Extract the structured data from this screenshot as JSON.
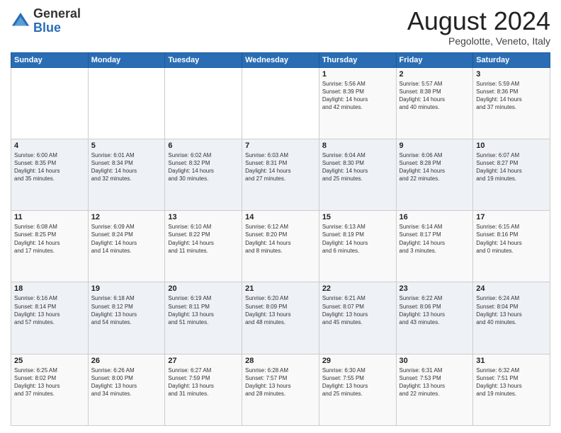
{
  "header": {
    "logo_general": "General",
    "logo_blue": "Blue",
    "month_title": "August 2024",
    "location": "Pegolotte, Veneto, Italy"
  },
  "weekdays": [
    "Sunday",
    "Monday",
    "Tuesday",
    "Wednesday",
    "Thursday",
    "Friday",
    "Saturday"
  ],
  "weeks": [
    [
      {
        "day": "",
        "info": ""
      },
      {
        "day": "",
        "info": ""
      },
      {
        "day": "",
        "info": ""
      },
      {
        "day": "",
        "info": ""
      },
      {
        "day": "1",
        "info": "Sunrise: 5:56 AM\nSunset: 8:39 PM\nDaylight: 14 hours\nand 42 minutes."
      },
      {
        "day": "2",
        "info": "Sunrise: 5:57 AM\nSunset: 8:38 PM\nDaylight: 14 hours\nand 40 minutes."
      },
      {
        "day": "3",
        "info": "Sunrise: 5:59 AM\nSunset: 8:36 PM\nDaylight: 14 hours\nand 37 minutes."
      }
    ],
    [
      {
        "day": "4",
        "info": "Sunrise: 6:00 AM\nSunset: 8:35 PM\nDaylight: 14 hours\nand 35 minutes."
      },
      {
        "day": "5",
        "info": "Sunrise: 6:01 AM\nSunset: 8:34 PM\nDaylight: 14 hours\nand 32 minutes."
      },
      {
        "day": "6",
        "info": "Sunrise: 6:02 AM\nSunset: 8:32 PM\nDaylight: 14 hours\nand 30 minutes."
      },
      {
        "day": "7",
        "info": "Sunrise: 6:03 AM\nSunset: 8:31 PM\nDaylight: 14 hours\nand 27 minutes."
      },
      {
        "day": "8",
        "info": "Sunrise: 6:04 AM\nSunset: 8:30 PM\nDaylight: 14 hours\nand 25 minutes."
      },
      {
        "day": "9",
        "info": "Sunrise: 6:06 AM\nSunset: 8:28 PM\nDaylight: 14 hours\nand 22 minutes."
      },
      {
        "day": "10",
        "info": "Sunrise: 6:07 AM\nSunset: 8:27 PM\nDaylight: 14 hours\nand 19 minutes."
      }
    ],
    [
      {
        "day": "11",
        "info": "Sunrise: 6:08 AM\nSunset: 8:25 PM\nDaylight: 14 hours\nand 17 minutes."
      },
      {
        "day": "12",
        "info": "Sunrise: 6:09 AM\nSunset: 8:24 PM\nDaylight: 14 hours\nand 14 minutes."
      },
      {
        "day": "13",
        "info": "Sunrise: 6:10 AM\nSunset: 8:22 PM\nDaylight: 14 hours\nand 11 minutes."
      },
      {
        "day": "14",
        "info": "Sunrise: 6:12 AM\nSunset: 8:20 PM\nDaylight: 14 hours\nand 8 minutes."
      },
      {
        "day": "15",
        "info": "Sunrise: 6:13 AM\nSunset: 8:19 PM\nDaylight: 14 hours\nand 6 minutes."
      },
      {
        "day": "16",
        "info": "Sunrise: 6:14 AM\nSunset: 8:17 PM\nDaylight: 14 hours\nand 3 minutes."
      },
      {
        "day": "17",
        "info": "Sunrise: 6:15 AM\nSunset: 8:16 PM\nDaylight: 14 hours\nand 0 minutes."
      }
    ],
    [
      {
        "day": "18",
        "info": "Sunrise: 6:16 AM\nSunset: 8:14 PM\nDaylight: 13 hours\nand 57 minutes."
      },
      {
        "day": "19",
        "info": "Sunrise: 6:18 AM\nSunset: 8:12 PM\nDaylight: 13 hours\nand 54 minutes."
      },
      {
        "day": "20",
        "info": "Sunrise: 6:19 AM\nSunset: 8:11 PM\nDaylight: 13 hours\nand 51 minutes."
      },
      {
        "day": "21",
        "info": "Sunrise: 6:20 AM\nSunset: 8:09 PM\nDaylight: 13 hours\nand 48 minutes."
      },
      {
        "day": "22",
        "info": "Sunrise: 6:21 AM\nSunset: 8:07 PM\nDaylight: 13 hours\nand 45 minutes."
      },
      {
        "day": "23",
        "info": "Sunrise: 6:22 AM\nSunset: 8:06 PM\nDaylight: 13 hours\nand 43 minutes."
      },
      {
        "day": "24",
        "info": "Sunrise: 6:24 AM\nSunset: 8:04 PM\nDaylight: 13 hours\nand 40 minutes."
      }
    ],
    [
      {
        "day": "25",
        "info": "Sunrise: 6:25 AM\nSunset: 8:02 PM\nDaylight: 13 hours\nand 37 minutes."
      },
      {
        "day": "26",
        "info": "Sunrise: 6:26 AM\nSunset: 8:00 PM\nDaylight: 13 hours\nand 34 minutes."
      },
      {
        "day": "27",
        "info": "Sunrise: 6:27 AM\nSunset: 7:59 PM\nDaylight: 13 hours\nand 31 minutes."
      },
      {
        "day": "28",
        "info": "Sunrise: 6:28 AM\nSunset: 7:57 PM\nDaylight: 13 hours\nand 28 minutes."
      },
      {
        "day": "29",
        "info": "Sunrise: 6:30 AM\nSunset: 7:55 PM\nDaylight: 13 hours\nand 25 minutes."
      },
      {
        "day": "30",
        "info": "Sunrise: 6:31 AM\nSunset: 7:53 PM\nDaylight: 13 hours\nand 22 minutes."
      },
      {
        "day": "31",
        "info": "Sunrise: 6:32 AM\nSunset: 7:51 PM\nDaylight: 13 hours\nand 19 minutes."
      }
    ]
  ]
}
